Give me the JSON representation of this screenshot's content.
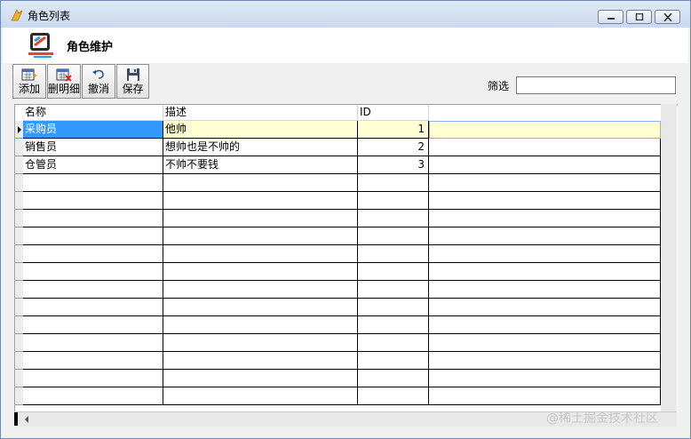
{
  "window": {
    "title": "角色列表"
  },
  "header": {
    "title": "角色维护"
  },
  "toolbar": {
    "buttons": [
      {
        "label": "添加",
        "icon": "add-icon"
      },
      {
        "label": "删明细",
        "icon": "delete-detail-icon"
      },
      {
        "label": "撤消",
        "icon": "undo-icon"
      },
      {
        "label": "保存",
        "icon": "save-icon"
      }
    ]
  },
  "filter": {
    "label": "筛选",
    "value": ""
  },
  "grid": {
    "columns": [
      "名称",
      "描述",
      "ID",
      ""
    ],
    "rows": [
      {
        "name": "采购员",
        "description": "他帅",
        "id": "1"
      },
      {
        "name": "销售员",
        "description": "想帅也是不帅的",
        "id": "2"
      },
      {
        "name": "仓管员",
        "description": "不帅不要钱",
        "id": "3"
      }
    ],
    "empty_rows": 13,
    "selected_row": 0
  },
  "colors": {
    "selected_row_bg": "#ffffd2",
    "selected_cell_bg": "#3399ff",
    "title_bar": "#dfe9f6"
  },
  "watermark": "@稀土掘金技术社区"
}
